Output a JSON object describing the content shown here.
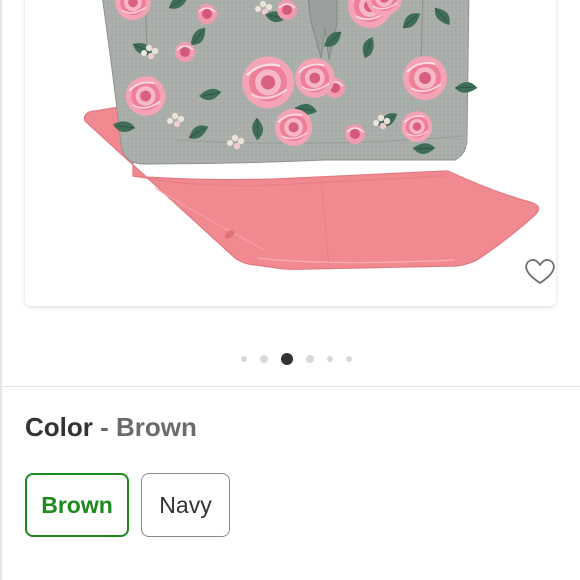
{
  "product": {
    "image_alt": "Floral diaper bag with pink changing pad",
    "favorite_icon": "heart-outline-icon"
  },
  "carousel": {
    "total": 6,
    "active_index": 2
  },
  "color": {
    "label": "Color",
    "separator": "-",
    "selected": "Brown",
    "options": [
      {
        "label": "Brown",
        "selected": true
      },
      {
        "label": "Navy",
        "selected": false
      }
    ]
  },
  "colors": {
    "selected_accent": "#1e8a1e",
    "pad_pink": "#f08a90",
    "bag_gray": "#a7aca8"
  }
}
